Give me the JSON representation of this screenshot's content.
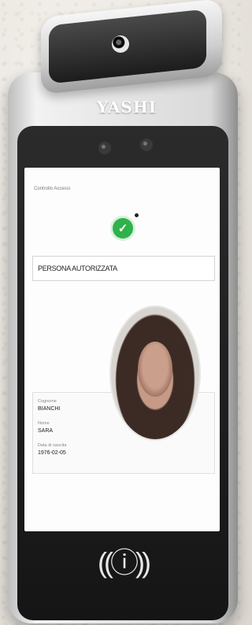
{
  "device": {
    "brand": "YASHI",
    "nfc_icon": "contactless-reader-icon"
  },
  "screen": {
    "title": "Controllo Accessi",
    "status": "PERSONA AUTORIZZATA",
    "check_icon": "check-circle-icon",
    "fields": [
      {
        "label": "Cognome",
        "value": "BIANCHI"
      },
      {
        "label": "Nome",
        "value": "SARA"
      },
      {
        "label": "Data di nascita",
        "value": "1976-02-05"
      }
    ]
  },
  "colors": {
    "success": "#2fb24a",
    "bezel": "#1c1c1c"
  }
}
